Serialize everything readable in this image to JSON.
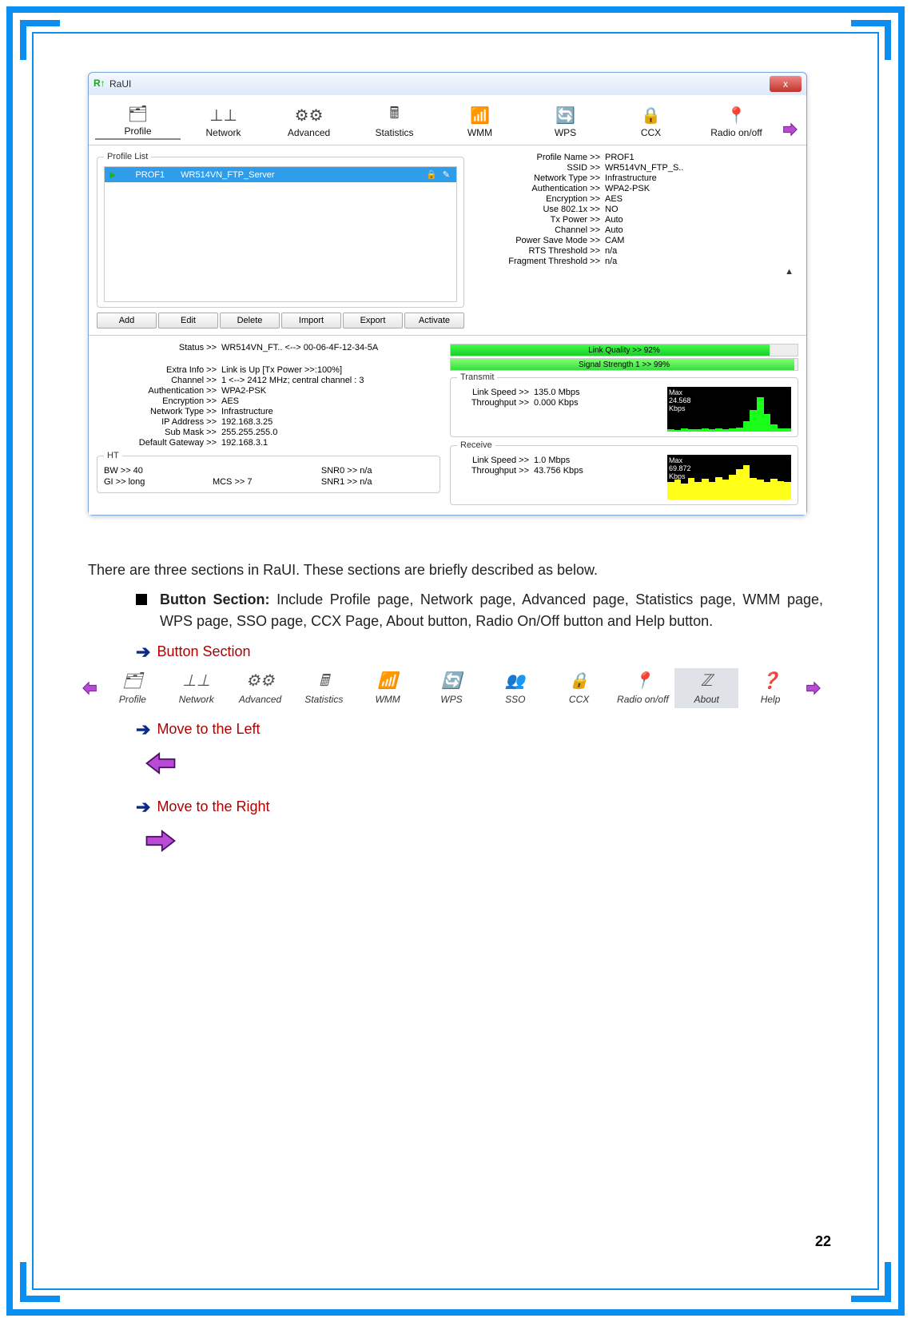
{
  "raui": {
    "title": "RaUI",
    "close": "x",
    "toolbar": {
      "items": [
        "Profile",
        "Network",
        "Advanced",
        "Statistics",
        "WMM",
        "WPS",
        "CCX",
        "Radio on/off"
      ]
    },
    "profile_list_legend": "Profile List",
    "profile_row": {
      "name": "PROF1",
      "ssid": "WR514VN_FTP_Server"
    },
    "buttons": {
      "add": "Add",
      "edit": "Edit",
      "delete": "Delete",
      "import": "Import",
      "export": "Export",
      "activate": "Activate"
    },
    "details": {
      "profile_name": {
        "k": "Profile Name >>",
        "v": "PROF1"
      },
      "ssid": {
        "k": "SSID >>",
        "v": "WR514VN_FTP_S.."
      },
      "nettype": {
        "k": "Network Type >>",
        "v": "Infrastructure"
      },
      "auth": {
        "k": "Authentication >>",
        "v": "WPA2-PSK"
      },
      "enc": {
        "k": "Encryption >>",
        "v": "AES"
      },
      "use8021x": {
        "k": "Use 802.1x >>",
        "v": "NO"
      },
      "txpower": {
        "k": "Tx Power >>",
        "v": "Auto"
      },
      "channel": {
        "k": "Channel >>",
        "v": "Auto"
      },
      "psm": {
        "k": "Power Save Mode >>",
        "v": "CAM"
      },
      "rts": {
        "k": "RTS Threshold >>",
        "v": "n/a"
      },
      "frag": {
        "k": "Fragment Threshold >>",
        "v": "n/a"
      }
    },
    "status": {
      "status": {
        "k": "Status >>",
        "v": "WR514VN_FT.. <--> 00-06-4F-12-34-5A"
      },
      "extra": {
        "k": "Extra Info >>",
        "v": "Link is Up [Tx Power >>:100%]"
      },
      "channel": {
        "k": "Channel >>",
        "v": "1 <--> 2412 MHz; central channel : 3"
      },
      "auth": {
        "k": "Authentication >>",
        "v": "WPA2-PSK"
      },
      "enc": {
        "k": "Encryption >>",
        "v": "AES"
      },
      "nettype": {
        "k": "Network Type >>",
        "v": "Infrastructure"
      },
      "ip": {
        "k": "IP Address >>",
        "v": "192.168.3.25"
      },
      "mask": {
        "k": "Sub Mask >>",
        "v": "255.255.255.0"
      },
      "gw": {
        "k": "Default Gateway >>",
        "v": "192.168.3.1"
      }
    },
    "ht_legend": "HT",
    "ht": {
      "bw": "BW >>  40",
      "snr0": "SNR0 >>  n/a",
      "gi": "GI >>  long",
      "mcs": "MCS >>  7",
      "snr1": "SNR1 >>  n/a"
    },
    "quality": {
      "lq_label": "Link Quality >> 92%",
      "lq_pct": 92,
      "ss_label": "Signal Strength 1 >> 99%",
      "ss_pct": 99
    },
    "tx_legend": "Transmit",
    "tx": {
      "speed": {
        "k": "Link Speed >>",
        "v": "135.0 Mbps"
      },
      "thru": {
        "k": "Throughput >>",
        "v": "0.000 Kbps"
      },
      "max": "Max",
      "val": "24.568\nKbps"
    },
    "rx_legend": "Receive",
    "rx": {
      "speed": {
        "k": "Link Speed >>",
        "v": "1.0 Mbps"
      },
      "thru": {
        "k": "Throughput >>",
        "v": "43.756 Kbps"
      },
      "max": "Max",
      "val": "69.872\nKbps"
    }
  },
  "doc": {
    "intro": "There are three sections in RaUI. These sections are briefly described as below.",
    "bullet_title": "Button Section:",
    "bullet_text": " Include Profile page, Network page, Advanced page, Statistics page, WMM page, WPS page, SSO page, CCX Page, About button, Radio On/Off button and Help button.",
    "arrow1": "Button Section",
    "strip_labels": [
      "Profile",
      "Network",
      "Advanced",
      "Statistics",
      "WMM",
      "WPS",
      "SSO",
      "CCX",
      "Radio on/off",
      "About",
      "Help"
    ],
    "arrow2": "Move to the Left",
    "arrow3": "Move to the Right",
    "page": "22"
  }
}
